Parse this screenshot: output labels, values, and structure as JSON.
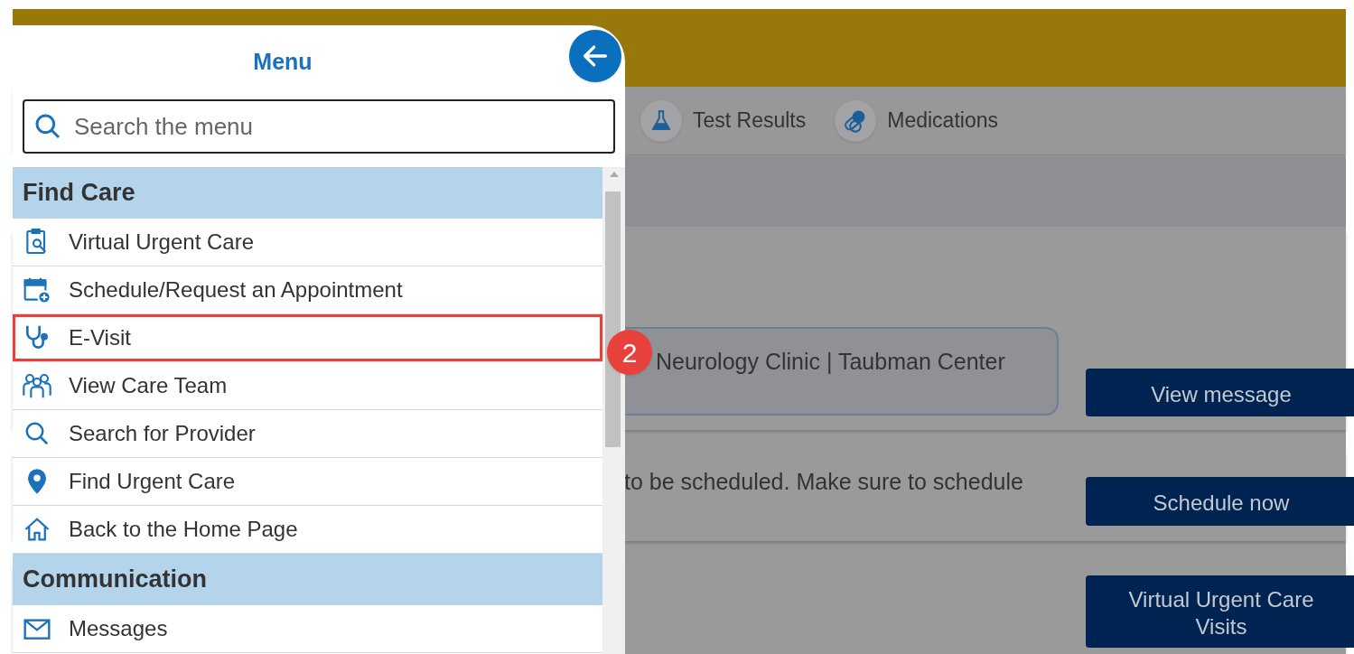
{
  "page": {
    "nav": [
      {
        "label": "Test Results",
        "kind": "flask"
      },
      {
        "label": "Medications",
        "kind": "pills"
      }
    ],
    "cards": [
      {
        "text": "Neurology Clinic | Taubman Center",
        "boxed": true,
        "button": "View message"
      },
      {
        "text": "to be scheduled. Make sure to schedule",
        "boxed": false,
        "button": "Schedule now"
      },
      {
        "boxed": false,
        "button": "Virtual Urgent Care Visits"
      }
    ]
  },
  "menu": {
    "title": "Menu",
    "search": {
      "placeholder": "Search the menu"
    },
    "sections": [
      {
        "title": "Find Care",
        "items": [
          {
            "label": "Virtual Urgent Care",
            "kind": "clipboard",
            "highlighted": false
          },
          {
            "label": "Schedule/Request an Appointment",
            "kind": "calendar",
            "highlighted": false
          },
          {
            "label": "E-Visit",
            "kind": "stethoscope",
            "highlighted": true
          },
          {
            "label": "View Care Team",
            "kind": "team",
            "highlighted": false
          },
          {
            "label": "Search for Provider",
            "kind": "search",
            "highlighted": false
          },
          {
            "label": "Find Urgent Care",
            "kind": "pin",
            "highlighted": false
          },
          {
            "label": "Back to the Home Page",
            "kind": "home",
            "highlighted": false
          }
        ]
      },
      {
        "title": "Communication",
        "items": [
          {
            "label": "Messages",
            "kind": "mail",
            "highlighted": false
          }
        ]
      }
    ]
  },
  "callout": {
    "number": "2"
  }
}
